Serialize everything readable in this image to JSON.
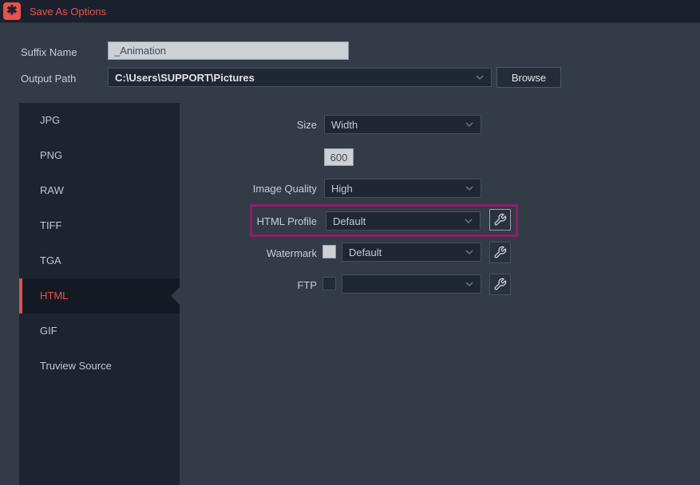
{
  "window": {
    "title": "Save As Options"
  },
  "icons": {
    "app_logo_glyph": "✱",
    "app_logo_name": "asterisk-logo-icon",
    "chevron_name": "chevron-down-icon",
    "wrench_name": "wrench-settings-icon"
  },
  "colors": {
    "accent_red": "#e8524d",
    "selected_border_red": "#d9534e",
    "highlight_magenta": "#8e2066",
    "titlebar_bg": "#1a212c",
    "content_bg": "#333b47",
    "sidebar_bg": "#1d242f",
    "combo_bg": "#1f2733",
    "light_input_bg": "#ccd1d8"
  },
  "fields": {
    "suffix_name": {
      "label": "Suffix Name",
      "value": "_Animation"
    },
    "output_path": {
      "label": "Output Path",
      "value": "C:\\Users\\SUPPORT\\Pictures"
    },
    "browse_label": "Browse"
  },
  "sidebar": {
    "items": [
      {
        "label": "JPG",
        "selected": false
      },
      {
        "label": "PNG",
        "selected": false
      },
      {
        "label": "RAW",
        "selected": false
      },
      {
        "label": "TIFF",
        "selected": false
      },
      {
        "label": "TGA",
        "selected": false
      },
      {
        "label": "HTML",
        "selected": true
      },
      {
        "label": "GIF",
        "selected": false
      },
      {
        "label": "Truview Source",
        "selected": false
      }
    ]
  },
  "main": {
    "size": {
      "label": "Size",
      "value": "Width"
    },
    "size_value": "600",
    "image_quality": {
      "label": "Image Quality",
      "value": "High"
    },
    "html_profile": {
      "label": "HTML Profile",
      "value": "Default",
      "highlighted": true
    },
    "watermark": {
      "label": "Watermark",
      "value": "Default",
      "checked": false
    },
    "ftp": {
      "label": "FTP",
      "value": "",
      "checked": false
    }
  }
}
